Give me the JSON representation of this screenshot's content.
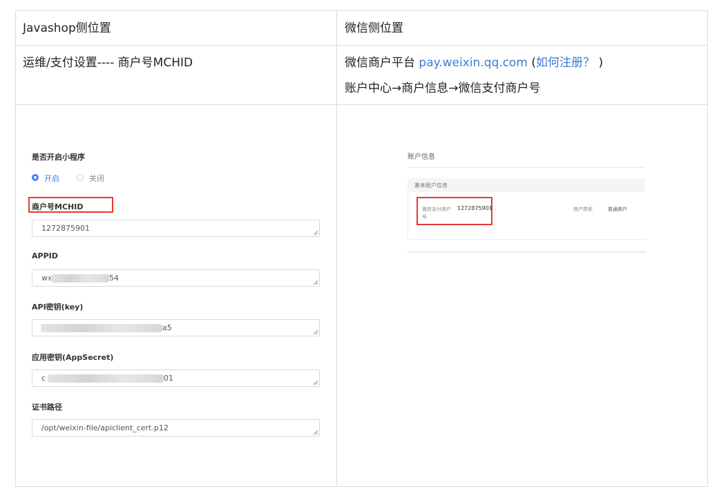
{
  "header": {
    "left": "Javashop侧位置",
    "right": "微信侧位置"
  },
  "row1": {
    "left": "运维/支付设置---- 商户号MCHID",
    "right_prefix": "微信商户平台 ",
    "right_link": "pay.weixin.qq.com",
    "right_paren_open": " (",
    "right_link2": "如何注册？",
    "right_paren_close": " )",
    "right_line2": "账户中心→商户信息→微信支付商户号"
  },
  "form": {
    "mini_program_label": "是否开启小程序",
    "radio_on": "开启",
    "radio_off": "关闭",
    "mchid_label": "商户号MCHID",
    "mchid_value": "1272875901",
    "appid_label": "APPID",
    "appid_value_start": "wx",
    "appid_value_end": "54",
    "apikey_label": "API密钥(key)",
    "apikey_value_end": "a5",
    "appsecret_label": "应用密钥(AppSecret)",
    "appsecret_value_start": "c",
    "appsecret_value_end": "01",
    "cert_label": "证书路径",
    "cert_value": "/opt/weixin-file/apiclient_cert.p12"
  },
  "account": {
    "title": "账户信息",
    "section": "基本账户信息",
    "mch_label_line1": "微信支付商户",
    "mch_label_line2": "号",
    "mch_value": "1272875901",
    "type_label": "商户类型",
    "type_value": "普通商户"
  },
  "colors": {
    "link": "#3b7bd4",
    "highlight_border": "#e53935",
    "radio_active": "#3b82f6"
  }
}
